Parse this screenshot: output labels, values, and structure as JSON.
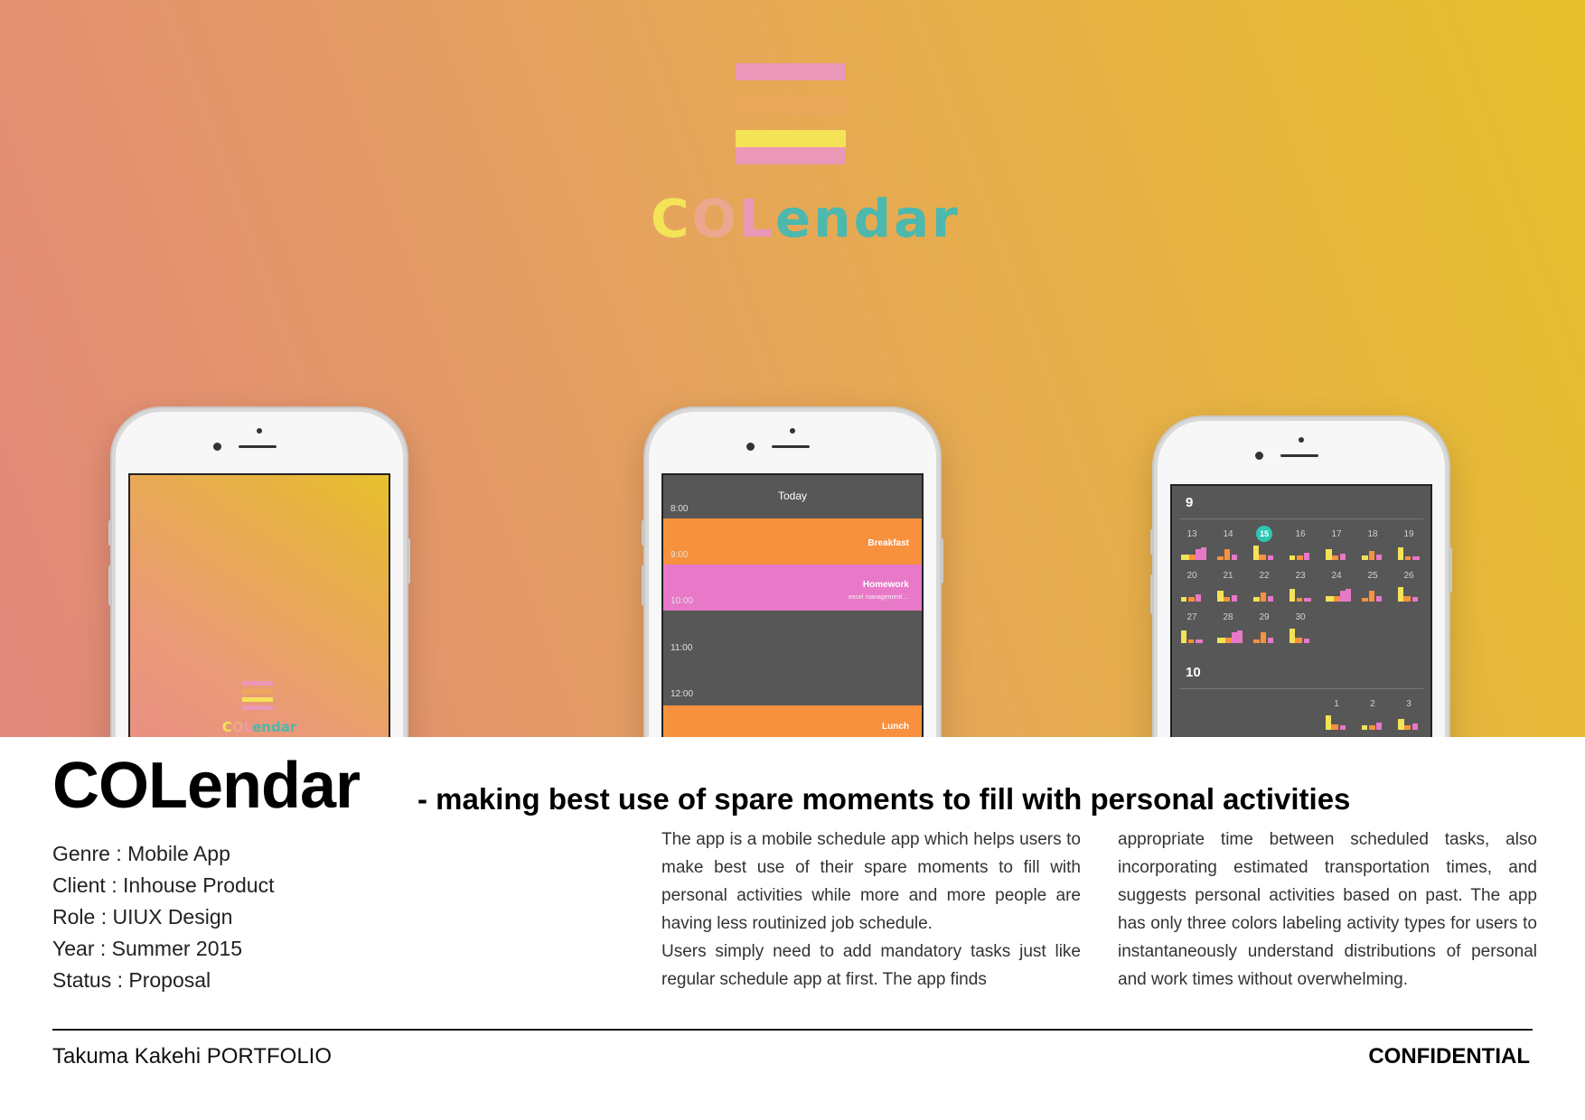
{
  "hero": {
    "logo_word": {
      "c": "C",
      "o": "O",
      "l": "L",
      "rest": "endar"
    },
    "colors": {
      "pink": "#eb97b8",
      "orange": "#eba75c",
      "yellow": "#f4e357",
      "teal": "#4cb8ae",
      "today": "#2ec6b3"
    }
  },
  "phone1": {
    "mini_word": {
      "c": "C",
      "o": "O",
      "l": "L",
      "rest": "endar"
    }
  },
  "phone2": {
    "title": "Today",
    "times": [
      "8:00",
      "9:00",
      "10:00",
      "11:00",
      "12:00"
    ],
    "events": [
      {
        "name": "Breakfast",
        "sub": "",
        "color": "#f7913e"
      },
      {
        "name": "Homework",
        "sub": "excel management ...",
        "color": "#e878c8"
      },
      {
        "name": "Lunch",
        "sub": "",
        "color": "#f7913e"
      }
    ]
  },
  "phone3": {
    "months": [
      "9",
      "10"
    ],
    "weeks": [
      [
        "13",
        "14",
        "15",
        "16",
        "17",
        "18",
        "19"
      ],
      [
        "20",
        "21",
        "22",
        "23",
        "24",
        "25",
        "26"
      ],
      [
        "27",
        "28",
        "29",
        "30"
      ]
    ],
    "next_month_days": [
      "1",
      "2",
      "3"
    ],
    "today": "15"
  },
  "title": "COLendar",
  "subtitle": "- making best use of spare moments to fill with personal activities",
  "meta": [
    "Genre : Mobile App",
    "Client : Inhouse Product",
    "Role : UIUX Design",
    "Year : Summer 2015",
    "Status : Proposal"
  ],
  "body": {
    "col1_p1": "The app is a mobile schedule app which helps users to make best use of their spare moments to fill with personal activities while more and more people are having less routinized job schedule.",
    "col1_p2": "Users simply need to add mandatory tasks just like regular schedule app at first. The app finds",
    "col2": "appropriate time between scheduled tasks, also incorporating estimated transportation times, and suggests personal activities based on past. The app has only three colors labeling activity types for users to instantaneously understand distributions of personal and work times without overwhelming."
  },
  "footer": {
    "left": "Takuma Kakehi PORTFOLIO",
    "right": "CONFIDENTIAL"
  }
}
